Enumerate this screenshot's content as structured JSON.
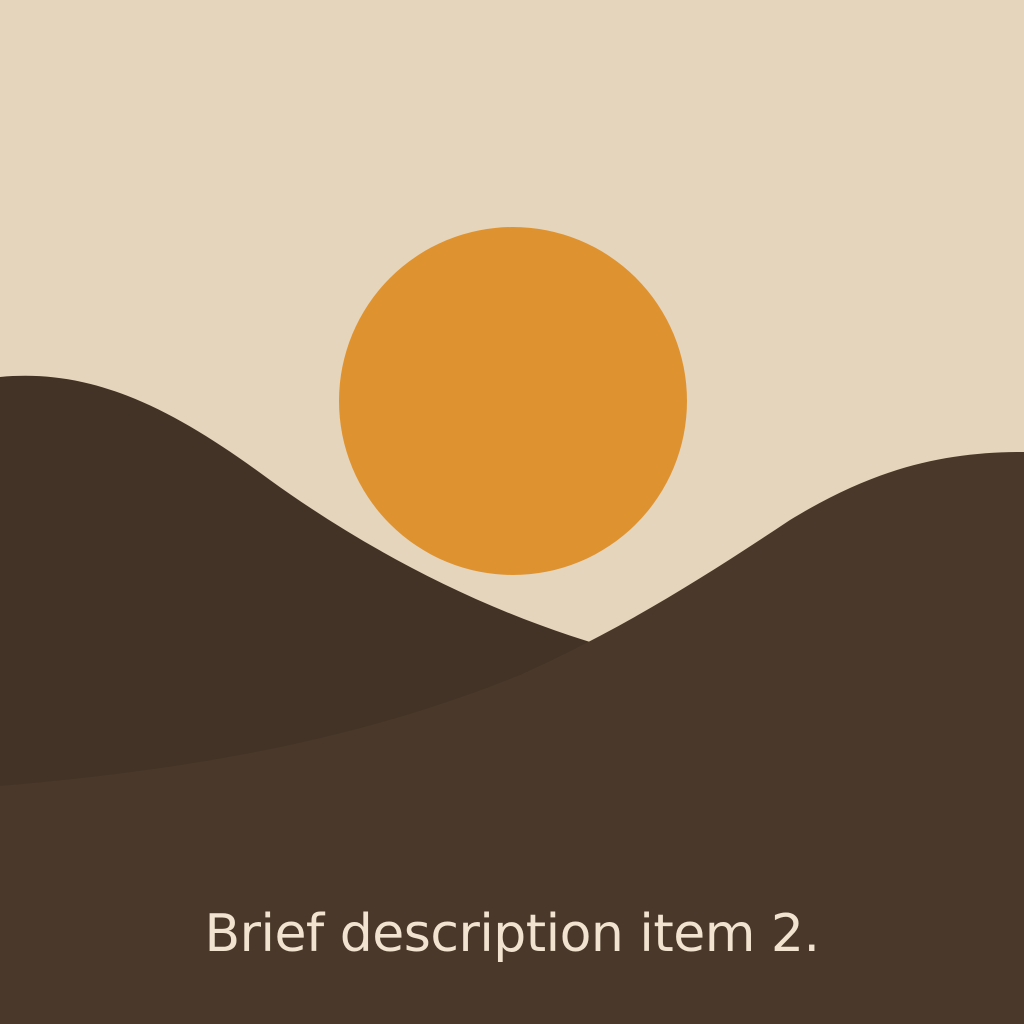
{
  "caption": {
    "text": "Brief description item 2."
  },
  "colors": {
    "sky": "#e6d5bd",
    "sun": "#df9330",
    "back_hill": "#433326",
    "front_hill": "#4a392a",
    "caption_text": "#f1e3cf"
  }
}
